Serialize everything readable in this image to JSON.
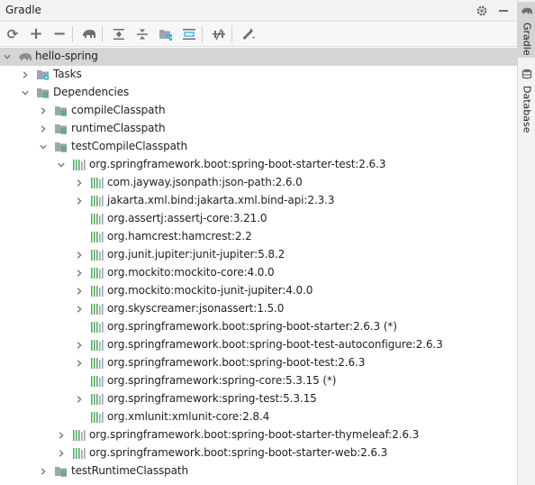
{
  "panel": {
    "title": "Gradle"
  },
  "side_tabs": [
    {
      "label": "Gradle",
      "icon": "elephant-icon",
      "active": true
    },
    {
      "label": "Database",
      "icon": "database-icon",
      "active": false
    }
  ],
  "toolbar": [
    {
      "name": "reload-all-projects-button",
      "glyph": "⟳",
      "icon": "reload-icon"
    },
    {
      "name": "add-project-button",
      "glyph": "+",
      "icon": "plus-icon"
    },
    {
      "name": "remove-project-button",
      "glyph": "−",
      "icon": "minus-icon"
    },
    {
      "name": "execute-task-button",
      "glyph": "",
      "icon": "elephant-icon"
    },
    {
      "name": "expand-all-button",
      "glyph": "",
      "icon": "expand-all-icon"
    },
    {
      "name": "collapse-all-button",
      "glyph": "",
      "icon": "collapse-all-icon"
    },
    {
      "name": "group-modules-button",
      "glyph": "",
      "icon": "group-modules-icon"
    },
    {
      "name": "analyze-dependencies-button",
      "glyph": "",
      "icon": "dependencies-icon"
    },
    {
      "name": "toggle-offline-mode-button",
      "glyph": "",
      "icon": "offline-mode-icon"
    },
    {
      "name": "build-settings-button",
      "glyph": "",
      "icon": "wrench-icon"
    }
  ],
  "tree": [
    {
      "label": "hello-spring",
      "level": 0,
      "arrow": "down",
      "icon": "gradle-project-icon",
      "selected": true
    },
    {
      "label": "Tasks",
      "level": 1,
      "arrow": "right",
      "icon": "tasks-folder-icon"
    },
    {
      "label": "Dependencies",
      "level": 1,
      "arrow": "down",
      "icon": "dependencies-folder-icon"
    },
    {
      "label": "compileClasspath",
      "level": 2,
      "arrow": "right",
      "icon": "configuration-icon"
    },
    {
      "label": "runtimeClasspath",
      "level": 2,
      "arrow": "right",
      "icon": "configuration-icon"
    },
    {
      "label": "testCompileClasspath",
      "level": 2,
      "arrow": "down",
      "icon": "configuration-icon"
    },
    {
      "label": "org.springframework.boot:spring-boot-starter-test:2.6.3",
      "level": 3,
      "arrow": "down",
      "icon": "library-icon"
    },
    {
      "label": "com.jayway.jsonpath:json-path:2.6.0",
      "level": 4,
      "arrow": "right",
      "icon": "library-icon"
    },
    {
      "label": "jakarta.xml.bind:jakarta.xml.bind-api:2.3.3",
      "level": 4,
      "arrow": "right",
      "icon": "library-icon"
    },
    {
      "label": "org.assertj:assertj-core:3.21.0",
      "level": 4,
      "arrow": "none",
      "icon": "library-icon"
    },
    {
      "label": "org.hamcrest:hamcrest:2.2",
      "level": 4,
      "arrow": "none",
      "icon": "library-icon"
    },
    {
      "label": "org.junit.jupiter:junit-jupiter:5.8.2",
      "level": 4,
      "arrow": "right",
      "icon": "library-icon"
    },
    {
      "label": "org.mockito:mockito-core:4.0.0",
      "level": 4,
      "arrow": "right",
      "icon": "library-icon"
    },
    {
      "label": "org.mockito:mockito-junit-jupiter:4.0.0",
      "level": 4,
      "arrow": "right",
      "icon": "library-icon"
    },
    {
      "label": "org.skyscreamer:jsonassert:1.5.0",
      "level": 4,
      "arrow": "right",
      "icon": "library-icon"
    },
    {
      "label": "org.springframework.boot:spring-boot-starter:2.6.3 (*)",
      "level": 4,
      "arrow": "none",
      "icon": "library-icon"
    },
    {
      "label": "org.springframework.boot:spring-boot-test-autoconfigure:2.6.3",
      "level": 4,
      "arrow": "right",
      "icon": "library-icon"
    },
    {
      "label": "org.springframework.boot:spring-boot-test:2.6.3",
      "level": 4,
      "arrow": "right",
      "icon": "library-icon"
    },
    {
      "label": "org.springframework:spring-core:5.3.15 (*)",
      "level": 4,
      "arrow": "none",
      "icon": "library-icon"
    },
    {
      "label": "org.springframework:spring-test:5.3.15",
      "level": 4,
      "arrow": "right",
      "icon": "library-icon"
    },
    {
      "label": "org.xmlunit:xmlunit-core:2.8.4",
      "level": 4,
      "arrow": "none",
      "icon": "library-icon"
    },
    {
      "label": "org.springframework.boot:spring-boot-starter-thymeleaf:2.6.3",
      "level": 3,
      "arrow": "right",
      "icon": "library-icon"
    },
    {
      "label": "org.springframework.boot:spring-boot-starter-web:2.6.3",
      "level": 3,
      "arrow": "right",
      "icon": "library-icon"
    },
    {
      "label": "testRuntimeClasspath",
      "level": 2,
      "arrow": "right",
      "icon": "configuration-icon"
    }
  ],
  "colors": {
    "library_bars": "#59a869",
    "folder": "#9aa7b0",
    "selection": "#d5d5d5"
  }
}
